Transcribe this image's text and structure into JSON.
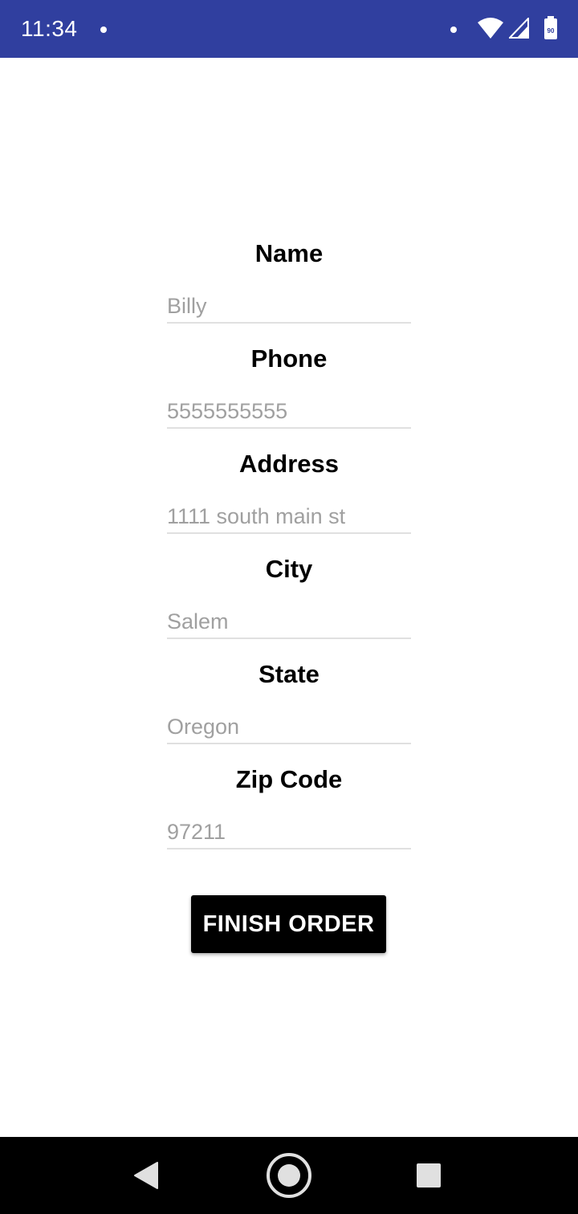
{
  "status_bar": {
    "time": "11:34",
    "background": "#303f9f",
    "icons": [
      "notification-dot-icon",
      "wifi-icon",
      "cellular-signal-icon",
      "battery-icon"
    ],
    "battery_level": "90"
  },
  "form": {
    "fields": [
      {
        "label": "Name",
        "placeholder": "Billy"
      },
      {
        "label": "Phone",
        "placeholder": "5555555555"
      },
      {
        "label": "Address",
        "placeholder": "1111 south main st"
      },
      {
        "label": "City",
        "placeholder": "Salem"
      },
      {
        "label": "State",
        "placeholder": "Oregon"
      },
      {
        "label": "Zip Code",
        "placeholder": "97211"
      }
    ],
    "submit_label": "FINISH ORDER"
  },
  "nav_bar": {
    "icons": [
      "back-icon",
      "home-icon",
      "recents-icon"
    ]
  },
  "colors": {
    "status_bar": "#303f9f",
    "button": "#000000",
    "placeholder": "#a0a0a0",
    "nav_bar": "#000000"
  }
}
